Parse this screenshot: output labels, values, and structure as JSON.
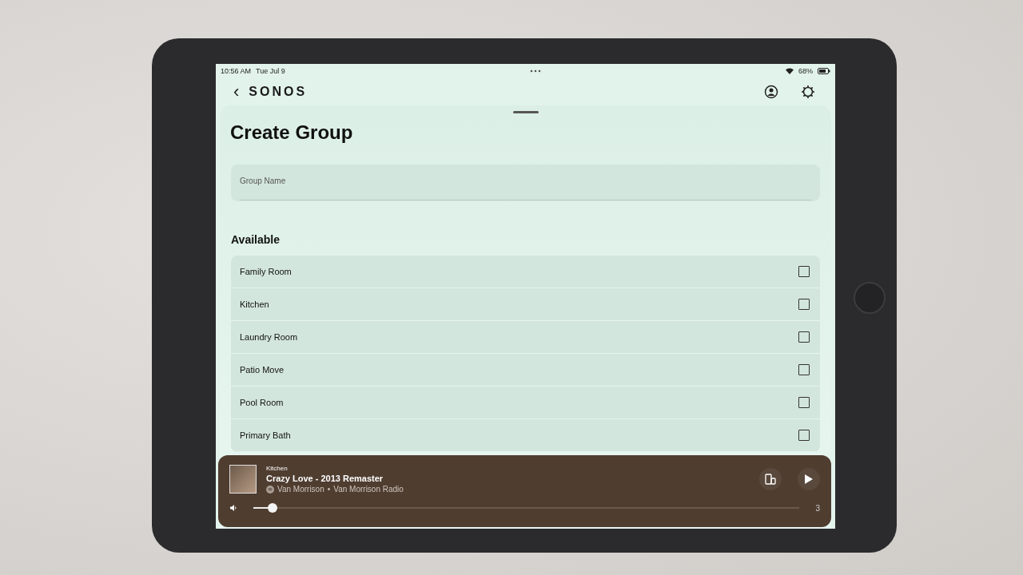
{
  "status_bar": {
    "time": "10:56 AM",
    "date": "Tue Jul 9",
    "battery": "68%"
  },
  "header": {
    "back": "‹",
    "logo": "SONOS"
  },
  "sheet": {
    "title": "Create Group",
    "group_name_field": {
      "placeholder": "Group Name"
    },
    "section": "Available",
    "rooms": [
      {
        "name": "Family Room",
        "checked": false
      },
      {
        "name": "Kitchen",
        "checked": false
      },
      {
        "name": "Laundry Room",
        "checked": false
      },
      {
        "name": "Patio Move",
        "checked": false
      },
      {
        "name": "Pool Room",
        "checked": false
      },
      {
        "name": "Primary Bath",
        "checked": false
      }
    ]
  },
  "now_playing": {
    "room": "Kitchen",
    "track": "Crazy Love - 2013 Remaster",
    "artist": "Van Morrison",
    "separator": "•",
    "station": "Van Morrison Radio",
    "volume": {
      "level": 0.035
    },
    "count": "3"
  }
}
